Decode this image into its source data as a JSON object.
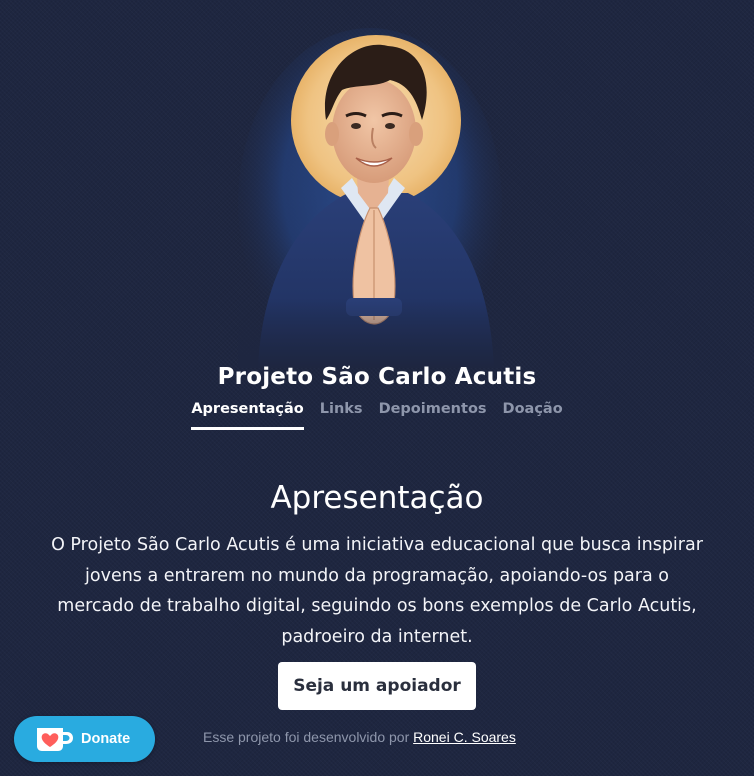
{
  "header": {
    "site_title": "Projeto São Carlo Acutis",
    "portrait_alt": "Carlo Acutis"
  },
  "nav": {
    "items": [
      {
        "label": "Apresentação",
        "active": true
      },
      {
        "label": "Links",
        "active": false
      },
      {
        "label": "Depoimentos",
        "active": false
      },
      {
        "label": "Doação",
        "active": false
      }
    ]
  },
  "section": {
    "heading": "Apresentação",
    "body": "O Projeto São Carlo Acutis é uma iniciativa educacional que busca inspirar jovens a entrarem no mundo da programação, apoiando-os para o mercado de trabalho digital, seguindo os bons exemplos de Carlo Acutis, padroeiro da internet."
  },
  "cta": {
    "support_label": "Seja um apoiador"
  },
  "donate_widget": {
    "label": "Donate",
    "icon": "kofi-cup-heart-icon",
    "color": "#29abe0"
  },
  "footer": {
    "text": "Esse projeto foi desenvolvido por",
    "author_link": "Ronei C. Soares"
  },
  "colors": {
    "background": "#1e2640",
    "nav_inactive": "#8e96ab",
    "halo": "#f0c98a"
  }
}
